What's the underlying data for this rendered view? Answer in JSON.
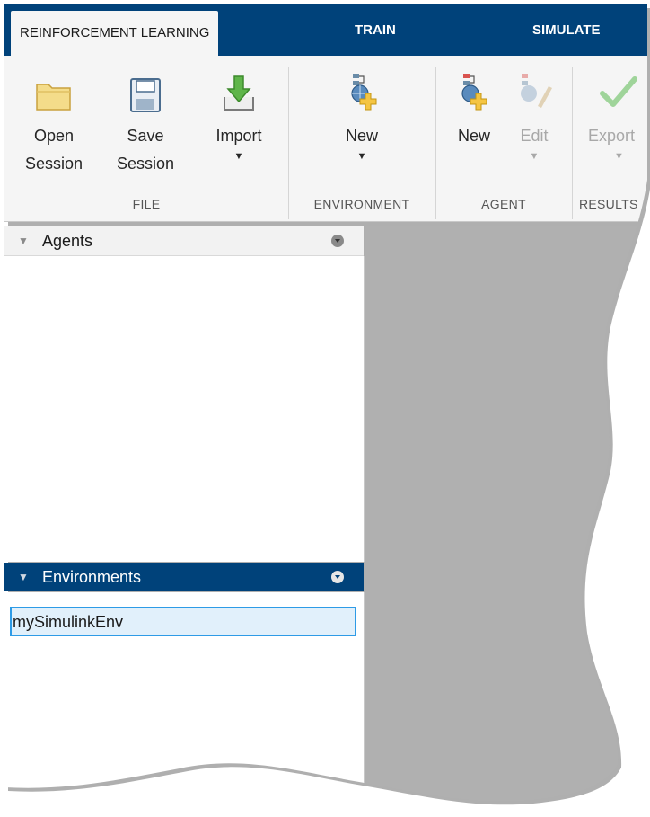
{
  "tabs": [
    {
      "label": "REINFORCEMENT LEARNING",
      "active": true
    },
    {
      "label": "TRAIN",
      "active": false
    },
    {
      "label": "SIMULATE",
      "active": false
    }
  ],
  "ribbon": {
    "file": {
      "label": "FILE",
      "open_line1": "Open",
      "open_line2": "Session",
      "save_line1": "Save",
      "save_line2": "Session",
      "import_label": "Import"
    },
    "environment": {
      "label": "ENVIRONMENT",
      "new_label": "New"
    },
    "agent": {
      "label": "AGENT",
      "new_label": "New",
      "edit_label": "Edit"
    },
    "results": {
      "label": "RESULTS",
      "export_label": "Export"
    }
  },
  "panels": {
    "agents": {
      "title": "Agents",
      "items": []
    },
    "environments": {
      "title": "Environments",
      "items": [
        "mySimulinkEnv"
      ]
    }
  },
  "colors": {
    "tab_bar": "#00427a",
    "selection_border": "#2e9be6",
    "selection_fill": "#e1f0fb",
    "document_area": "#b0b0b0"
  },
  "icons": [
    "folder-icon",
    "save-disk-icon",
    "import-arrow-icon",
    "new-environment-icon",
    "new-agent-icon",
    "edit-agent-icon",
    "export-check-icon",
    "collapse-triangle-icon",
    "panel-menu-icon"
  ]
}
